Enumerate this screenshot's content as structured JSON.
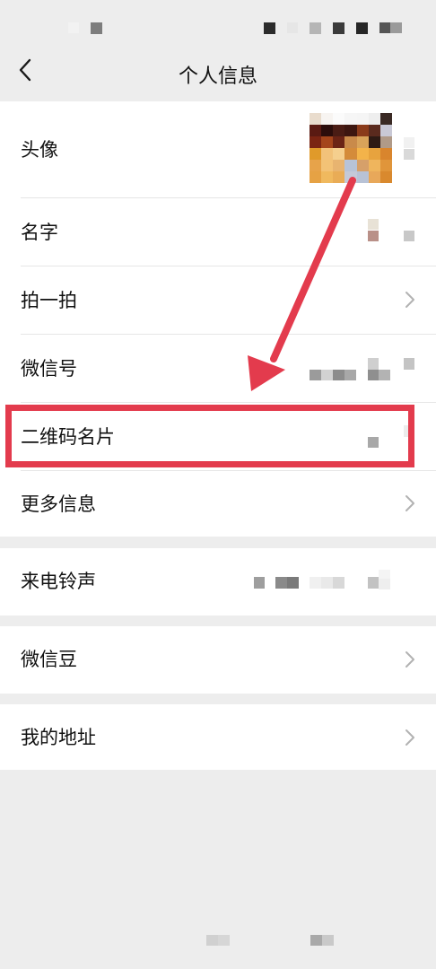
{
  "nav": {
    "title": "个人信息"
  },
  "profile_rows": [
    {
      "label": "头像"
    },
    {
      "label": "名字"
    },
    {
      "label": "拍一拍"
    },
    {
      "label": "微信号"
    },
    {
      "label": "二维码名片"
    },
    {
      "label": "更多信息"
    }
  ],
  "ringtone_row": {
    "label": "来电铃声"
  },
  "beans_row": {
    "label": "微信豆"
  },
  "address_row": {
    "label": "我的地址"
  },
  "icons": {
    "back": "chevron-left-icon",
    "chevron": "chevron-right-icon",
    "arrow": "annotation-arrow"
  },
  "colors": {
    "background": "#ededed",
    "card": "#ffffff",
    "annotation": "#e33b4d",
    "text": "#111111",
    "chevron": "#b2b2b2"
  }
}
